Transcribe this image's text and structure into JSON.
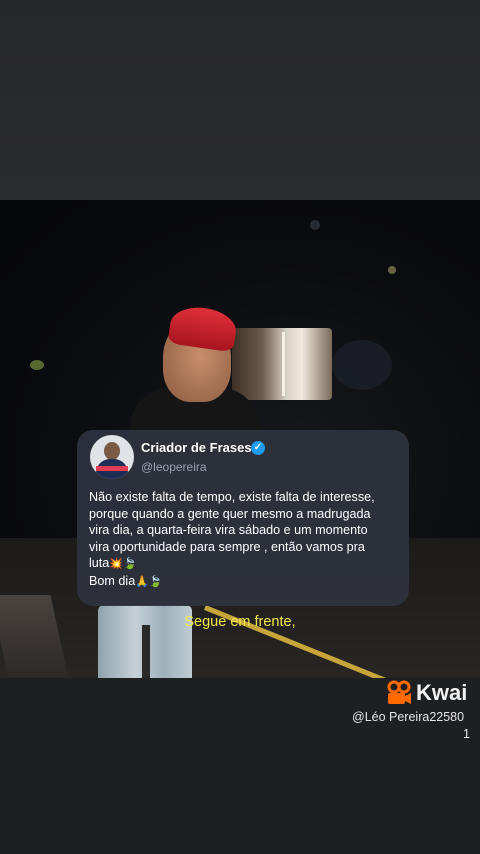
{
  "post": {
    "author_name": "Criador de Frases",
    "author_handle": "@leopereira",
    "verified_icon": "check-icon",
    "line1": "Não existe falta de tempo, existe falta de interesse,",
    "line2": "porque quando a gente quer mesmo a madrugada",
    "line3": "vira dia, a quarta-feira vira sábado e um momento",
    "line4": "vira oportunidade para sempre , então vamos pra",
    "line5_text": "luta",
    "line5_emojis": "💥🍃",
    "line6_text": "Bom dia",
    "line6_emojis": "🙏🍃"
  },
  "video": {
    "caption": "Segue em frente,"
  },
  "watermark": {
    "brand": "Kwai",
    "user_line1": "@Léo Pereira22580",
    "user_line2": "1",
    "accent": "#ff6a00"
  }
}
